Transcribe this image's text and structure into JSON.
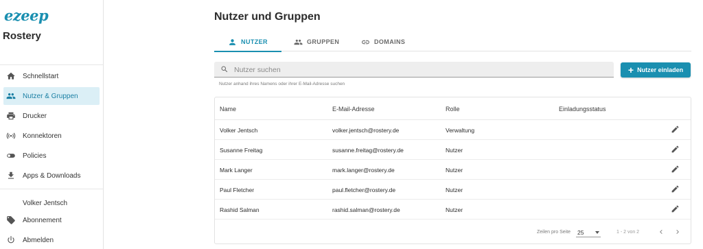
{
  "sidebar": {
    "logo": "ezeep",
    "company": "Rostery",
    "nav": [
      {
        "label": "Schnellstart",
        "icon": "home-icon",
        "active": false
      },
      {
        "label": "Nutzer & Gruppen",
        "icon": "people-icon",
        "active": true
      },
      {
        "label": "Drucker",
        "icon": "printer-icon",
        "active": false
      },
      {
        "label": "Konnektoren",
        "icon": "connector-icon",
        "active": false
      },
      {
        "label": "Policies",
        "icon": "toggle-icon",
        "active": false
      },
      {
        "label": "Apps & Downloads",
        "icon": "download-icon",
        "active": false
      }
    ],
    "user_name": "Volker Jentsch",
    "account": [
      {
        "label": "Abonnement",
        "icon": "tag-icon"
      },
      {
        "label": "Abmelden",
        "icon": "power-icon"
      }
    ]
  },
  "header": {
    "title": "Nutzer und Gruppen"
  },
  "tabs": [
    {
      "label": "NUTZER",
      "icon": "person-icon",
      "active": true
    },
    {
      "label": "GRUPPEN",
      "icon": "group-icon",
      "active": false
    },
    {
      "label": "DOMAINS",
      "icon": "link-icon",
      "active": false
    }
  ],
  "search": {
    "placeholder": "Nutzer suchen",
    "value": "",
    "hint": "Nutzer anhand ihres Namens oder ihrer E-Mail-Adresse suchen"
  },
  "invite_button": {
    "label": "Nutzer einladen"
  },
  "table": {
    "columns": [
      "Name",
      "E-Mail-Adresse",
      "Rolle",
      "Einladungsstatus"
    ],
    "rows": [
      {
        "name": "Volker Jentsch",
        "email": "volker.jentsch@rostery.de",
        "role": "Verwaltung",
        "status": ""
      },
      {
        "name": "Susanne Freitag",
        "email": "susanne.freitag@rostery.de",
        "role": "Nutzer",
        "status": ""
      },
      {
        "name": "Mark Langer",
        "email": "mark.langer@rostery.de",
        "role": "Nutzer",
        "status": ""
      },
      {
        "name": "Paul Fletcher",
        "email": "paul.fletcher@rostery.de",
        "role": "Nutzer",
        "status": ""
      },
      {
        "name": "Rashid Salman",
        "email": "rashid.salman@rostery.de",
        "role": "Nutzer",
        "status": ""
      }
    ]
  },
  "pagination": {
    "rows_per_page_label": "Zeilen pro Seite",
    "rows_per_page": "25",
    "range": "1 - 2 von 2"
  },
  "colors": {
    "accent": "#1a8fb0",
    "active_nav_bg": "#dbeff6"
  }
}
